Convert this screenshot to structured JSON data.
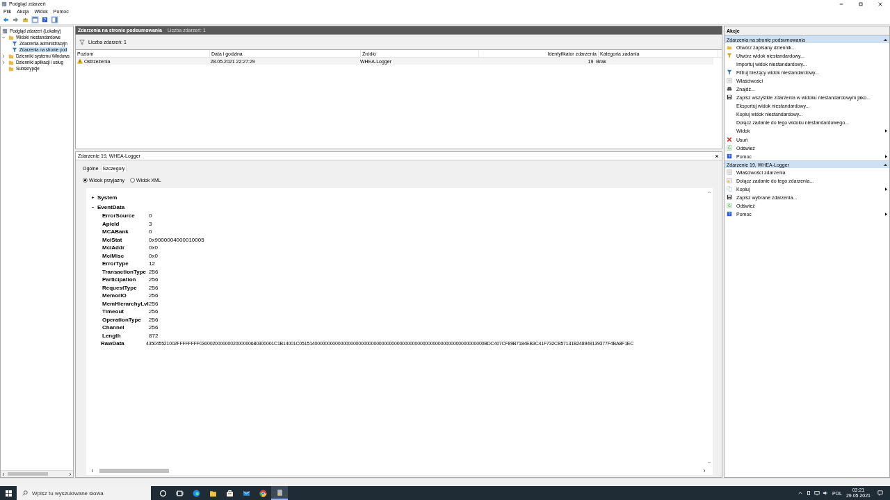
{
  "window": {
    "title": "Podgląd zdarzeń"
  },
  "menu": [
    "Plik",
    "Akcja",
    "Widok",
    "Pomoc"
  ],
  "tree": [
    {
      "label": "Podgląd zdarzeń (Lokalny)",
      "selected": false,
      "children": [
        {
          "label": "Widoki niestandardowe",
          "selected": false,
          "expanded": true,
          "children": [
            {
              "label": "Zdarzenia administracyjn",
              "selected": false
            },
            {
              "label": "Zdarzenia na stronie pod",
              "selected": true
            }
          ]
        },
        {
          "label": "Dzienniki systemu Windows",
          "selected": false,
          "expanded": false
        },
        {
          "label": "Dzienniki aplikacji i usług",
          "selected": false,
          "expanded": false
        },
        {
          "label": "Subskrypcje",
          "selected": false
        }
      ]
    }
  ],
  "center": {
    "title": "Zdarzenia na stronie podsumowania",
    "count_label": "Liczba zdarzeń: 1",
    "filter_label": "Liczba zdarzeń: 1",
    "columns": [
      "Poziom",
      "Data i godzina",
      "Źródło",
      "Identyfikator zdarzenia",
      "Kategoria zadania"
    ],
    "rows": [
      {
        "level": "Ostrzeżenia",
        "date": "28.05.2021 22:27:29",
        "source": "WHEA-Logger",
        "id": "19",
        "category": "Brak",
        "selected": false
      }
    ]
  },
  "details": {
    "title": "Zdarzenie 19, WHEA-Logger",
    "tabs": [
      {
        "label": "Ogólne",
        "selected": false
      },
      {
        "label": "Szczegóły",
        "selected": true
      }
    ],
    "views": [
      {
        "label": "Widok przyjazny",
        "selected": true
      },
      {
        "label": "Widok XML",
        "selected": false
      }
    ],
    "nodes": [
      {
        "label": "System",
        "expanded": false
      },
      {
        "label": "EventData",
        "expanded": true,
        "fields": [
          {
            "name": "ErrorSource",
            "value": "0"
          },
          {
            "name": "ApicId",
            "value": "3"
          },
          {
            "name": "MCABank",
            "value": "0"
          },
          {
            "name": "MciStat",
            "value": "0x9000004000010005"
          },
          {
            "name": "MciAddr",
            "value": "0x0"
          },
          {
            "name": "MciMisc",
            "value": "0x0"
          },
          {
            "name": "ErrorType",
            "value": "12"
          },
          {
            "name": "TransactionType",
            "value": "256"
          },
          {
            "name": "Participation",
            "value": "256"
          },
          {
            "name": "RequestType",
            "value": "256"
          },
          {
            "name": "MemorIO",
            "value": "256"
          },
          {
            "name": "MemHierarchyLvl",
            "value": "256"
          },
          {
            "name": "Timeout",
            "value": "256"
          },
          {
            "name": "OperationType",
            "value": "256"
          },
          {
            "name": "Channel",
            "value": "256"
          },
          {
            "name": "Length",
            "value": "872"
          }
        ]
      }
    ],
    "raw_label": "RawData",
    "raw_value": "435045521002FFFFFFFF03000200000002000000680300001C1B14001C051514000000000000000000000000000000000000000000000000000000000000000000BDC407CF89B7184EB3C41F732CB57131B248949139377F4BA8F1EC"
  },
  "actions": {
    "title": "Akcje",
    "sections": [
      {
        "title": "Zdarzenia na stronie podsumowania",
        "items": [
          {
            "label": "Otwórz zapisany dziennik...",
            "submenu": false
          },
          {
            "label": "Utwórz widok niestandardowy...",
            "submenu": false
          },
          {
            "label": "Importuj widok niestandardowy...",
            "submenu": false
          },
          {
            "label": "Filtruj bieżący widok niestandardowy...",
            "submenu": false
          },
          {
            "label": "Właściwości",
            "submenu": false
          },
          {
            "label": "Znajdź...",
            "submenu": false
          },
          {
            "label": "Zapisz wszystkie zdarzenia w widoku niestandardowym jako...",
            "submenu": false
          },
          {
            "label": "Eksportuj widok niestandardowy...",
            "submenu": false
          },
          {
            "label": "Kopiuj widok niestandardowy...",
            "submenu": false
          },
          {
            "label": "Dołącz zadanie do tego widoku niestandardowego...",
            "submenu": false
          },
          {
            "label": "Widok",
            "submenu": true
          },
          {
            "label": "Usuń",
            "submenu": false
          },
          {
            "label": "Odśwież",
            "submenu": false
          },
          {
            "label": "Pomoc",
            "submenu": true
          }
        ]
      },
      {
        "title": "Zdarzenie 19, WHEA-Logger",
        "items": [
          {
            "label": "Właściwości zdarzenia",
            "submenu": false
          },
          {
            "label": "Dołącz zadanie do tego zdarzenia...",
            "submenu": false
          },
          {
            "label": "Kopiuj",
            "submenu": true
          },
          {
            "label": "Zapisz wybrane zdarzenia...",
            "submenu": false
          },
          {
            "label": "Odśwież",
            "submenu": false
          },
          {
            "label": "Pomoc",
            "submenu": true
          }
        ]
      }
    ]
  },
  "taskbar": {
    "search_placeholder": "Wpisz tu wyszukiwane słowa",
    "apps": [
      {
        "kind": "cortana",
        "active": false
      },
      {
        "kind": "taskview",
        "active": false
      },
      {
        "kind": "edge",
        "active": false
      },
      {
        "kind": "explorer",
        "active": false
      },
      {
        "kind": "store",
        "active": false
      },
      {
        "kind": "mail",
        "active": false
      },
      {
        "kind": "chrome",
        "active": false
      },
      {
        "kind": "eventviewer",
        "active": true
      }
    ],
    "language": "POL",
    "time": "03:21",
    "date": "29.05.2021"
  }
}
